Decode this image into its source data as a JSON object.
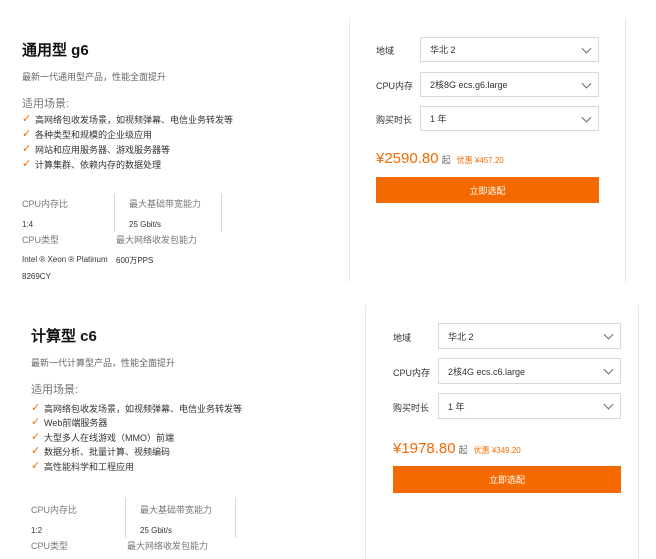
{
  "cards": [
    {
      "title": "通用型 g6",
      "desc": "最新一代通用型产品，性能全面提升",
      "scene_label": "适用场景:",
      "features": [
        "高网络包收发场景，如视频弹幕、电信业务转发等",
        "各种类型和规模的企业级应用",
        "网站和应用服务器、游戏服务器等",
        "计算集群、依赖内存的数据处理"
      ],
      "specs": {
        "ratio_label": "CPU内存比",
        "ratio_value": "1:4",
        "bandwidth_label": "最大基础带宽能力",
        "bandwidth_value": "25 Gbit/s",
        "cpu_type_label": "CPU类型",
        "cpu_type_value_1": "Intel ® Xeon ® Platinum",
        "cpu_type_value_2": "8269CY",
        "pps_label": "最大网络收发包能力",
        "pps_value": "600万PPS"
      },
      "config": {
        "region_label": "地域",
        "region_value": "华北 2",
        "cpu_mem_label": "CPU内存",
        "cpu_mem_value": "2核8G ecs.g6.large",
        "duration_label": "购买时长",
        "duration_value": "1 年",
        "price": "¥2590.80",
        "price_unit": "起",
        "discount": "优惠 ¥457.20",
        "button": "立即选配"
      }
    },
    {
      "title": "计算型 c6",
      "desc": "最新一代计算型产品，性能全面提升",
      "scene_label": "适用场景:",
      "features": [
        "高网络包收发场景，如视频弹幕、电信业务转发等",
        "Web前端服务器",
        "大型多人在线游戏（MMO）前端",
        "数据分析、批量计算、视频编码",
        "高性能科学和工程应用"
      ],
      "specs": {
        "ratio_label": "CPU内存比",
        "ratio_value": "1:2",
        "bandwidth_label": "最大基础带宽能力",
        "bandwidth_value": "25 Gbit/s",
        "cpu_type_label": "CPU类型",
        "pps_label": "最大网络收发包能力"
      },
      "config": {
        "region_label": "地域",
        "region_value": "华北 2",
        "cpu_mem_label": "CPU内存",
        "cpu_mem_value": "2核4G ecs.c6.large",
        "duration_label": "购买时长",
        "duration_value": "1 年",
        "price": "¥1978.80",
        "price_unit": "起",
        "discount": "优惠 ¥349.20",
        "button": "立即选配"
      }
    }
  ],
  "colors": {
    "accent": "#f56a00"
  },
  "icons": {
    "feature_bullet": "check-icon",
    "select_arrow": "chevron-down-icon"
  }
}
